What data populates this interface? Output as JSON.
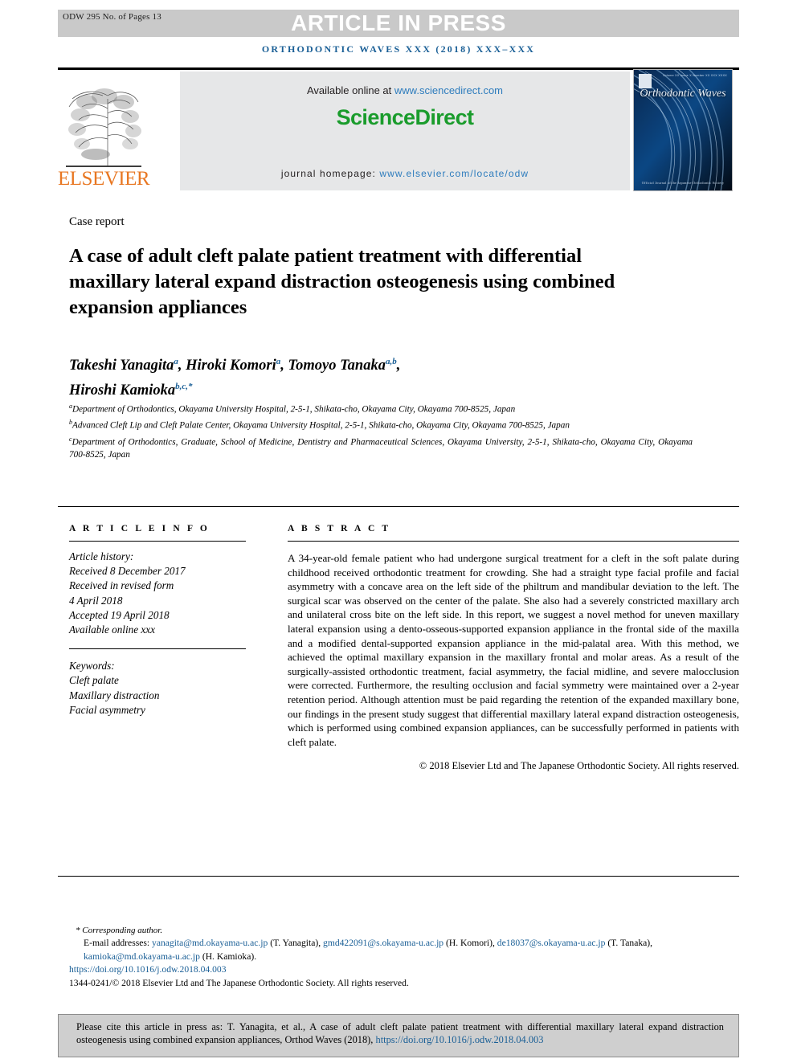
{
  "runhead": "ODW 295 No. of Pages 13",
  "banner": {
    "article_in_press": "ARTICLE IN PRESS",
    "journal_reference": "ORTHODONTIC WAVES XXX (2018) XXX–XXX",
    "banner_bg": "#c9c9c9",
    "reference_color": "#1a5f96"
  },
  "publisher_bar": {
    "elsevier_wordmark": "ELSEVIER",
    "elsevier_color": "#e87722",
    "available_prefix": "Available online at",
    "sciencedirect_url": "www.sciencedirect.com",
    "sciencedirect_brand": "ScienceDirect",
    "sciencedirect_color": "#1a9c2c",
    "homepage_label": "journal homepage:",
    "homepage_url": "www.elsevier.com/locate/odw",
    "link_color": "#2d7cbd",
    "cover": {
      "title": "Orthodontic Waves",
      "volume_line": "Volume XX Issue X Number XX XXX XXXX",
      "footer_line": "Official Journal of the Japanese Orthodontic Society"
    }
  },
  "article": {
    "type": "Case report",
    "title": "A case of adult cleft palate patient treatment with differential maxillary lateral expand distraction osteogenesis using combined expansion appliances",
    "authors": [
      {
        "name": "Takeshi Yanagita",
        "marks": "a",
        "sep": ", "
      },
      {
        "name": "Hiroki Komori",
        "marks": "a",
        "sep": ", "
      },
      {
        "name": "Tomoyo Tanaka",
        "marks": "a,b",
        "sep": ", "
      },
      {
        "name": "Hiroshi Kamioka",
        "marks": "b,c,*",
        "sep": ""
      }
    ],
    "affiliations": [
      {
        "mark": "a",
        "text": "Department of Orthodontics, Okayama University Hospital, 2-5-1, Shikata-cho, Okayama City, Okayama 700-8525, Japan"
      },
      {
        "mark": "b",
        "text": "Advanced Cleft Lip and Cleft Palate Center, Okayama University Hospital, 2-5-1, Shikata-cho, Okayama City, Okayama 700-8525, Japan"
      },
      {
        "mark": "c",
        "text": "Department of Orthodontics, Graduate, School of Medicine, Dentistry and Pharmaceutical Sciences, Okayama University, 2-5-1, Shikata-cho, Okayama City, Okayama 700-8525, Japan"
      }
    ]
  },
  "article_info": {
    "heading": "A R T I C L E   I N F O",
    "history_label": "Article history:",
    "history": [
      "Received 8 December 2017",
      "Received in revised form",
      "4 April 2018",
      "Accepted 19 April 2018",
      "Available online xxx"
    ],
    "keywords_label": "Keywords:",
    "keywords": [
      "Cleft palate",
      "Maxillary distraction",
      "Facial asymmetry"
    ]
  },
  "abstract": {
    "heading": "A B S T R A C T",
    "body": "A 34-year-old female patient who had undergone surgical treatment for a cleft in the soft palate during childhood received orthodontic treatment for crowding. She had a straight type facial profile and facial asymmetry with a concave area on the left side of the philtrum and mandibular deviation to the left. The surgical scar was observed on the center of the palate. She also had a severely constricted maxillary arch and unilateral cross bite on the left side. In this report, we suggest a novel method for uneven maxillary lateral expansion using a dento-osseous-supported expansion appliance in the frontal side of the maxilla and a modified dental-supported expansion appliance in the mid-palatal area. With this method, we achieved the optimal maxillary expansion in the maxillary frontal and molar areas. As a result of the surgically-assisted orthodontic treatment, facial asymmetry, the facial midline, and severe malocclusion were corrected. Furthermore, the resulting occlusion and facial symmetry were maintained over a 2-year retention period. Although attention must be paid regarding the retention of the expanded maxillary bone, our findings in the present study suggest that differential maxillary lateral expand distraction osteogenesis, which is performed using combined expansion appliances, can be successfully performed in patients with cleft palate.",
    "copyright": "© 2018 Elsevier Ltd and The Japanese Orthodontic Society. All rights reserved."
  },
  "footnote": {
    "corresponding_author": "* Corresponding author.",
    "email_label": "E-mail addresses:",
    "emails": [
      {
        "address": "yanagita@md.okayama-u.ac.jp",
        "person": "(T. Yanagita),"
      },
      {
        "address": "gmd422091@s.okayama-u.ac.jp",
        "person": "(H. Komori),"
      },
      {
        "address": "de18037@s.okayama-u.ac.jp",
        "person": "(T. Tanaka),"
      },
      {
        "address": "kamioka@md.okayama-u.ac.jp",
        "person": "(H. Kamioka)."
      }
    ],
    "doi": "https://doi.org/10.1016/j.odw.2018.04.003",
    "issn_line": "1344-0241/© 2018 Elsevier Ltd and The Japanese Orthodontic Society. All rights reserved."
  },
  "cite_box": {
    "text": "Please cite this article in press as: T. Yanagita, et al., A case of adult cleft palate patient treatment with differential maxillary lateral expand distraction osteogenesis using combined expansion appliances, Orthod Waves (2018),",
    "doi": "https://doi.org/10.1016/j.odw.2018.04.003",
    "bg": "#cfcfcf"
  }
}
